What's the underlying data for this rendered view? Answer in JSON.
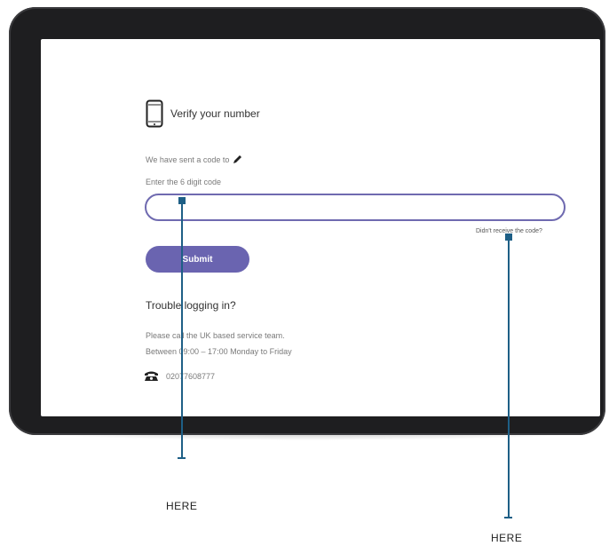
{
  "verify": {
    "title": "Verify your number"
  },
  "sent_text": "We have sent a code to",
  "enter_label": "Enter the 6 digit code",
  "code_input": {
    "value": "",
    "placeholder": ""
  },
  "resend_link": "Didn't receive the code?",
  "submit_label": "Submit",
  "trouble": {
    "heading": "Trouble logging in?",
    "line1": "Please call the UK based service team.",
    "line2": "Between 09:00 – 17:00 Monday to Friday",
    "phone": "02077608777"
  },
  "markers": {
    "left_label": "HERE",
    "right_label": "HERE"
  },
  "colors": {
    "accent": "#6a64b0",
    "marker": "#1e5f86",
    "bezel": "#1e1e20"
  }
}
